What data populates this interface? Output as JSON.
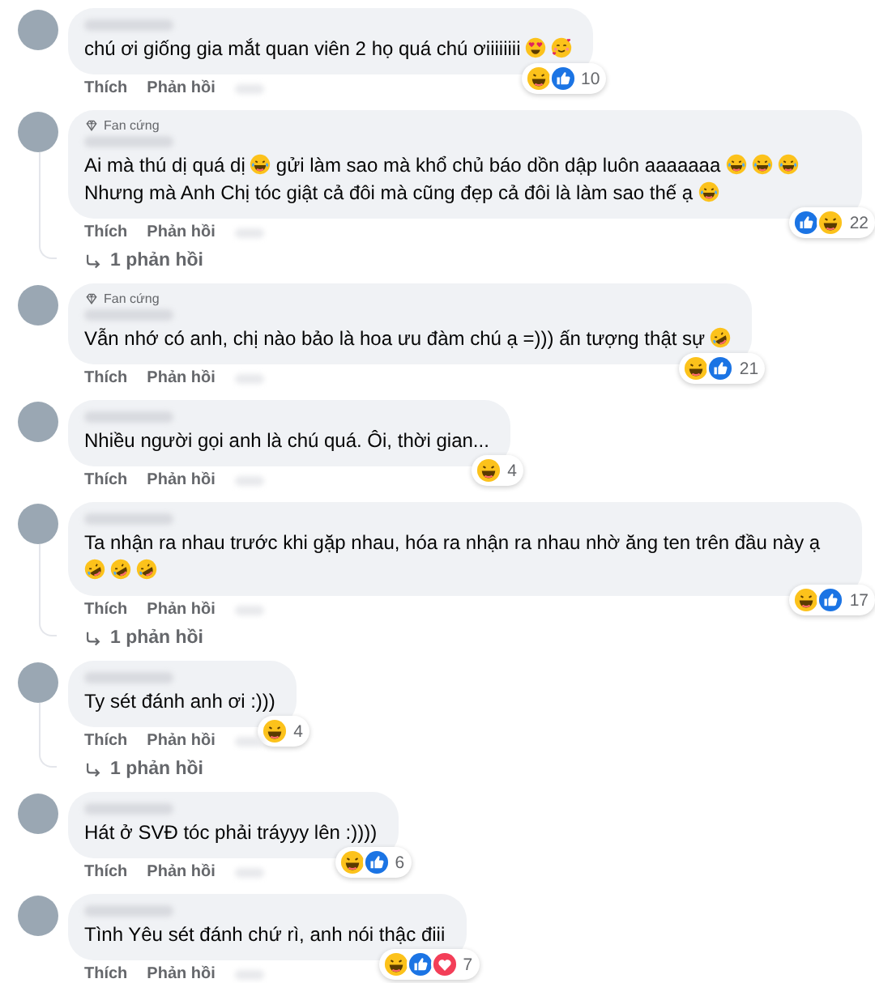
{
  "comments": [
    {
      "body": [
        {
          "kind": "text",
          "text": "chú ơi giống gia mắt quan viên 2 họ quá chú ơiiiiiiii"
        },
        {
          "kind": "heart-eyes"
        },
        {
          "kind": "hearts-face"
        }
      ],
      "reactions": [
        {
          "kind": "haha"
        },
        {
          "kind": "like"
        }
      ],
      "reaction_count": "10",
      "actions": [
        "Thích",
        "Phản hồi"
      ]
    },
    {
      "badge": "Fan cứng",
      "body": [
        {
          "kind": "text",
          "text": "Ai mà thú dị quá dị"
        },
        {
          "kind": "tears-of-joy"
        },
        {
          "kind": "text",
          "text": "gửi làm sao mà khổ chủ báo dồn dập luôn aaaaaaa"
        },
        {
          "kind": "tears-of-joy"
        },
        {
          "kind": "tears-of-joy"
        },
        {
          "kind": "tears-of-joy"
        },
        {
          "kind": "text",
          "text": "Nhưng mà Anh Chị tóc giật cả đôi mà cũng đẹp cả đôi là làm sao thế ạ"
        },
        {
          "kind": "tears-of-joy"
        }
      ],
      "reactions": [
        {
          "kind": "like"
        },
        {
          "kind": "haha"
        }
      ],
      "reaction_count": "22",
      "actions": [
        "Thích",
        "Phản hồi"
      ],
      "replies": "1 phản hồi"
    },
    {
      "badge": "Fan cứng",
      "body": [
        {
          "kind": "text",
          "text": "Vẫn nhớ có anh, chị nào bảo là hoa ưu đàm chú ạ =))) ấn tượng thật sự"
        },
        {
          "kind": "rolling-laugh"
        }
      ],
      "reactions": [
        {
          "kind": "haha"
        },
        {
          "kind": "like"
        }
      ],
      "reaction_count": "21",
      "actions": [
        "Thích",
        "Phản hồi"
      ]
    },
    {
      "body": [
        {
          "kind": "text",
          "text": "Nhiều người gọi anh là chú quá. Ôi, thời gian..."
        }
      ],
      "reactions": [
        {
          "kind": "haha"
        }
      ],
      "reaction_count": "4",
      "actions": [
        "Thích",
        "Phản hồi"
      ]
    },
    {
      "body": [
        {
          "kind": "text",
          "text": "Ta nhận ra nhau trước khi gặp nhau, hóa ra nhận ra nhau nhờ ăng ten trên đầu này ạ"
        },
        {
          "kind": "rolling-laugh"
        },
        {
          "kind": "rolling-laugh"
        },
        {
          "kind": "rolling-laugh"
        }
      ],
      "reactions": [
        {
          "kind": "haha"
        },
        {
          "kind": "like"
        }
      ],
      "reaction_count": "17",
      "actions": [
        "Thích",
        "Phản hồi"
      ],
      "replies": "1 phản hồi"
    },
    {
      "body": [
        {
          "kind": "text",
          "text": "Ty sét đánh anh ơi :)))"
        }
      ],
      "reactions": [
        {
          "kind": "haha"
        }
      ],
      "reaction_count": "4",
      "actions": [
        "Thích",
        "Phản hồi"
      ],
      "replies": "1 phản hồi"
    },
    {
      "body": [
        {
          "kind": "text",
          "text": "Hát ở SVĐ tóc phải tráyyy lên :))))"
        }
      ],
      "reactions": [
        {
          "kind": "haha"
        },
        {
          "kind": "like"
        }
      ],
      "reaction_count": "6",
      "actions": [
        "Thích",
        "Phản hồi"
      ]
    },
    {
      "body": [
        {
          "kind": "text",
          "text": "Tình Yêu sét đánh chứ rì, anh nói thậc điii"
        }
      ],
      "reactions": [
        {
          "kind": "haha"
        },
        {
          "kind": "like"
        },
        {
          "kind": "love"
        }
      ],
      "reaction_count": "7",
      "actions": [
        "Thích",
        "Phản hồi"
      ]
    }
  ]
}
